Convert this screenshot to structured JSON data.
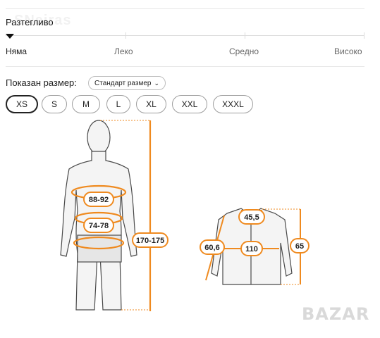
{
  "stretch": {
    "title": "Разтегливо",
    "levels": [
      "Няма",
      "Леко",
      "Средно",
      "Високо"
    ],
    "selected_index": 0
  },
  "size_chart": {
    "shown_label": "Показан размер:",
    "select_value": "Стандарт размер",
    "sizes": [
      "XS",
      "S",
      "M",
      "L",
      "XL",
      "XXL",
      "XXXL"
    ],
    "selected_size": "XS"
  },
  "body_measurements": {
    "chest": "88-92",
    "waist": "74-78",
    "height": "170-175"
  },
  "garment_measurements": {
    "shoulder": "45,5",
    "sleeve": "60,6",
    "chest": "110",
    "length": "65"
  },
  "watermarks": {
    "top": "SNeiras",
    "bottom": "BAZAR"
  },
  "colors": {
    "accent": "#ef8a1f",
    "figure_fill": "#f4f4f4",
    "figure_stroke": "#4a4a4a"
  }
}
